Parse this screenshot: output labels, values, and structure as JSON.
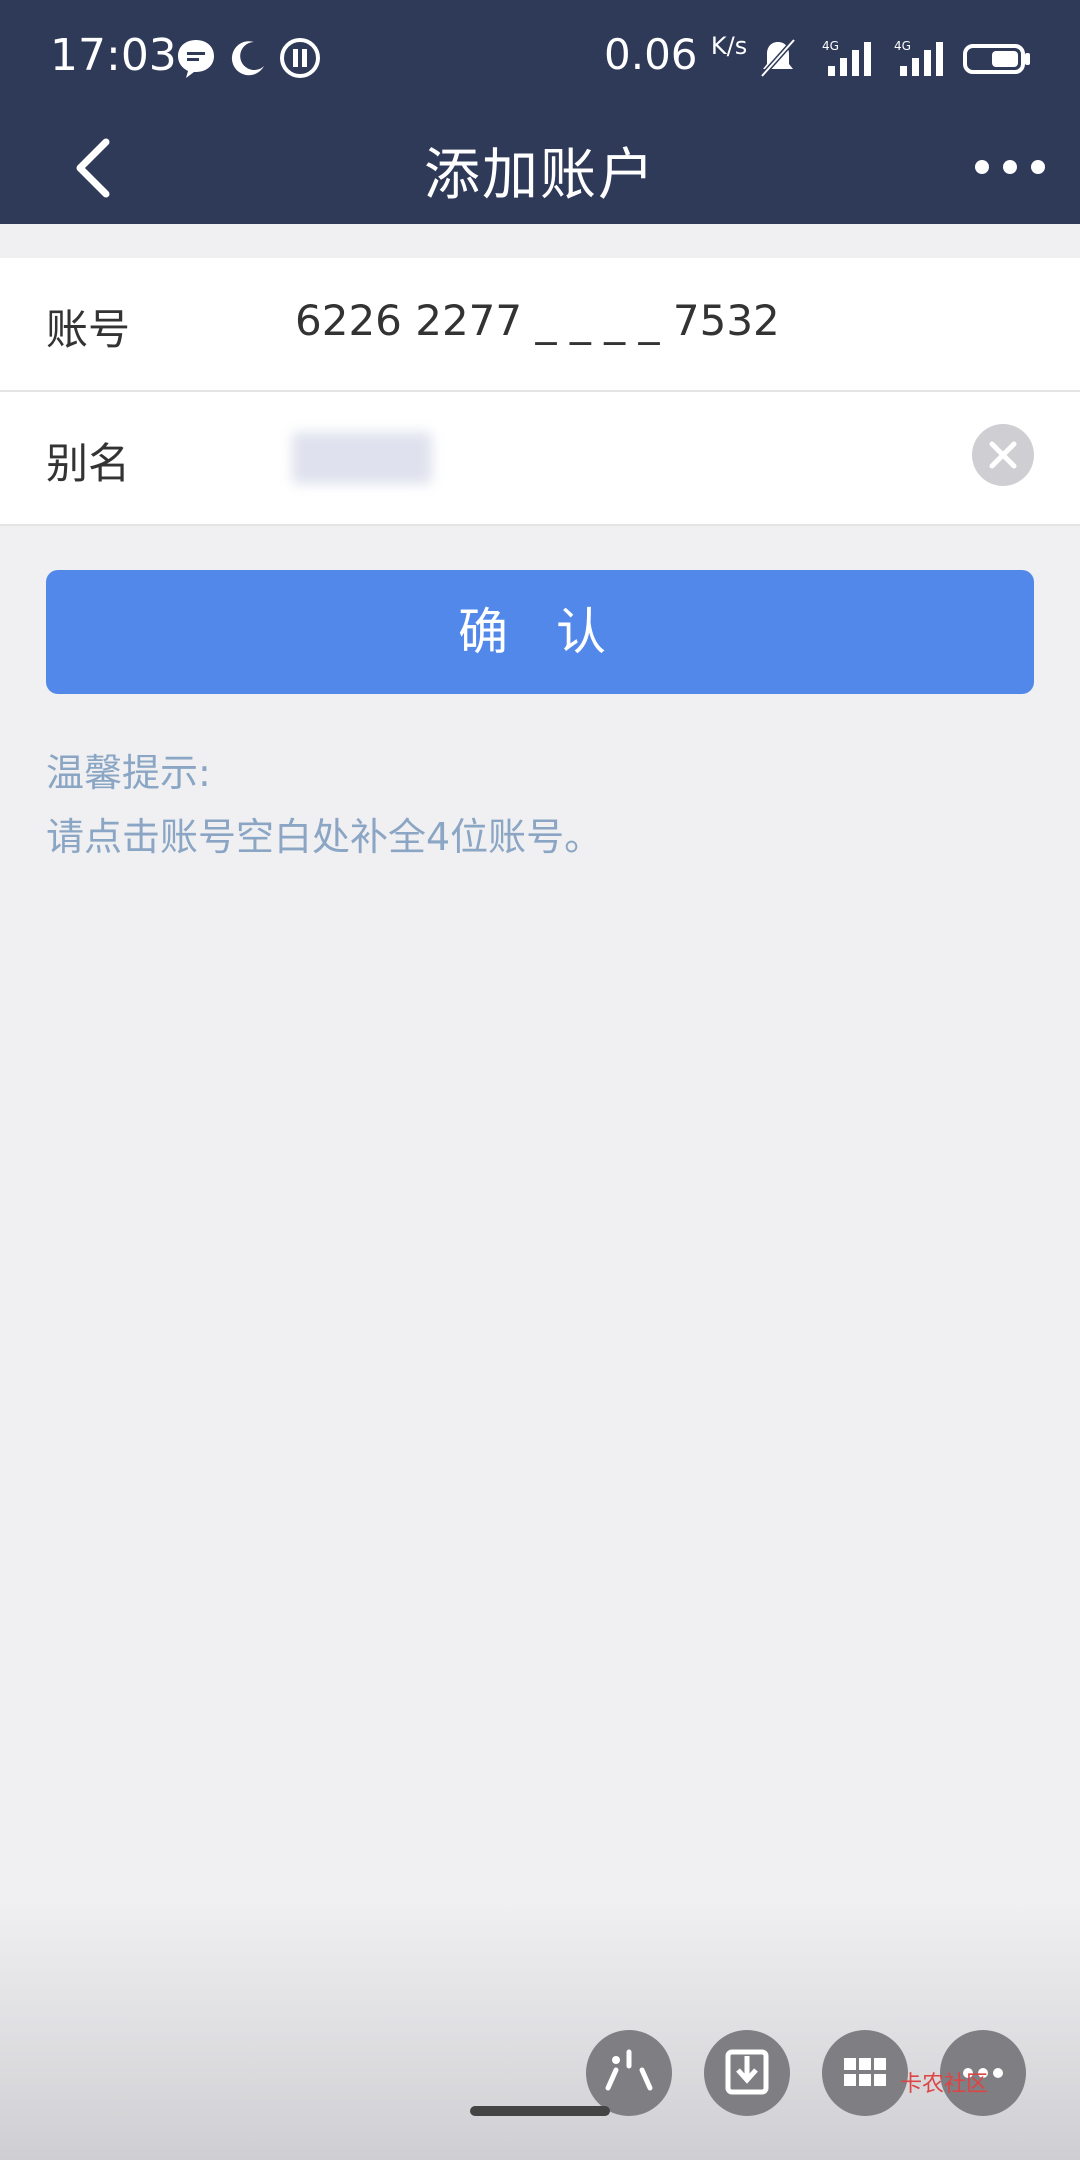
{
  "status_bar": {
    "time": "17:03",
    "net_speed": "0.06",
    "net_unit": "K/s",
    "icons": [
      "message-bubble-icon",
      "moon-icon",
      "pause-circle-icon",
      "bell-muted-icon",
      "signal-4g-icon",
      "signal-4g-icon",
      "battery-icon"
    ]
  },
  "header": {
    "title": "添加账户",
    "back_icon": "chevron-left-icon",
    "more_icon": "more-dots-icon"
  },
  "form": {
    "account": {
      "label": "账号",
      "value": "6226 2277 _ _ _ _ 7532"
    },
    "alias": {
      "label": "别名"
    }
  },
  "confirm_button": {
    "label": "确 认",
    "color": "#5188e9"
  },
  "tips": {
    "title": "温馨提示:",
    "text": "请点击账号空白处补全4位账号。"
  },
  "floating_toolbar": {
    "icons": [
      "sparkle-icon",
      "download-icon",
      "grid-icon",
      "more-icon"
    ]
  },
  "watermark": {
    "text": "卡农社区"
  },
  "colors": {
    "header_bg": "#2f3a59",
    "page_bg": "#f0f0f2",
    "tip_text": "#8aa6c4"
  }
}
